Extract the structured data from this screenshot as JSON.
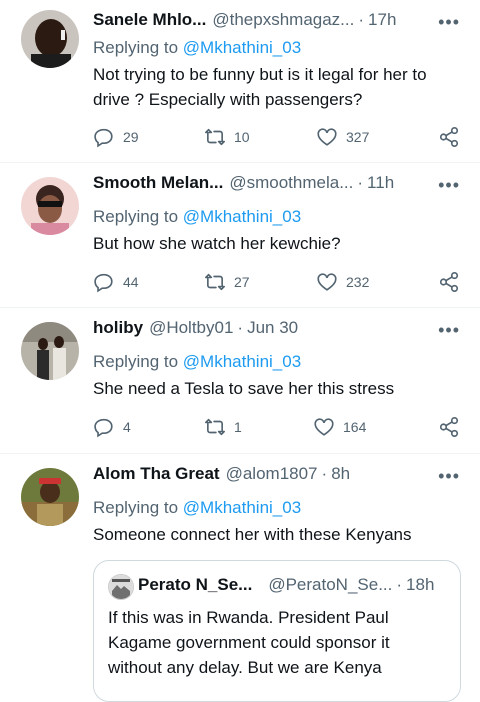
{
  "tweets": [
    {
      "name": "Sanele Mhlo...",
      "handle": "@thepxshmagaz...",
      "time": "17h",
      "reply_prefix": "Replying to",
      "reply_to": "@Mkhathini_03",
      "text": "Not trying to be funny but is it legal for her to drive ? Especially with passengers?",
      "replies": "29",
      "retweets": "10",
      "likes": "327"
    },
    {
      "name": "Smooth Melan...",
      "handle": "@smoothmela...",
      "time": "11h",
      "reply_prefix": "Replying to",
      "reply_to": "@Mkhathini_03",
      "text": "But how she watch her kewchie?",
      "replies": "44",
      "retweets": "27",
      "likes": "232"
    },
    {
      "name": "holiby",
      "handle": "@Holtby01",
      "time": "Jun 30",
      "reply_prefix": "Replying to",
      "reply_to": "@Mkhathini_03",
      "text": "She need a Tesla to save her this stress",
      "replies": "4",
      "retweets": "1",
      "likes": "164"
    },
    {
      "name": "Alom Tha Great",
      "handle": "@alom1807",
      "time": "8h",
      "reply_prefix": "Replying to",
      "reply_to": "@Mkhathini_03",
      "text": "Someone connect her with these Kenyans",
      "quote": {
        "name": "Perato N_Se...",
        "handle": "@PeratoN_Se...",
        "time": "18h",
        "text": "If this was in Rwanda. President Paul Kagame government could sponsor it without any delay. But we are Kenya"
      }
    }
  ],
  "colors": {
    "accent": "#1d9bf0",
    "muted": "#536471",
    "text": "#0f1419",
    "divider": "#eff3f4"
  },
  "icons": [
    "reply-icon",
    "retweet-icon",
    "like-icon",
    "share-icon",
    "more-icon"
  ],
  "more_label": "•••",
  "separator": "·"
}
